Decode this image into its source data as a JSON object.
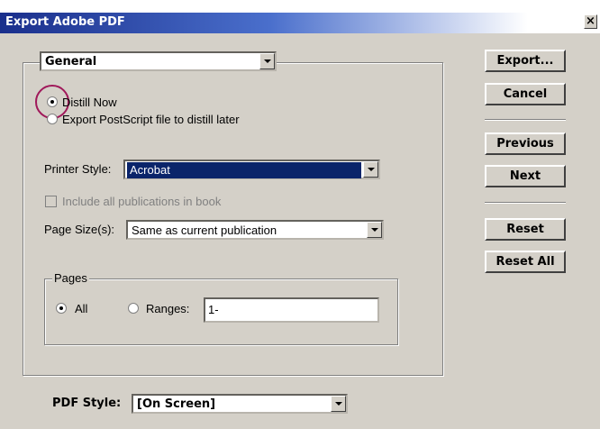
{
  "window": {
    "title": "Export Adobe PDF",
    "close_glyph": "×"
  },
  "category_select": {
    "value": "General"
  },
  "distill": {
    "now_label": "Distill Now",
    "later_label": "Export PostScript file to distill later",
    "selected": "now"
  },
  "printer_style": {
    "label": "Printer Style:",
    "value": "Acrobat"
  },
  "include_all": {
    "label": "Include all publications in book"
  },
  "page_size": {
    "label": "Page Size(s):",
    "value": "Same as current publication"
  },
  "pages": {
    "group_label": "Pages",
    "all_label": "All",
    "ranges_label": "Ranges:",
    "ranges_value": "1-"
  },
  "pdf_style": {
    "label": "PDF Style:",
    "value": "[On Screen]"
  },
  "buttons": {
    "export": "Export...",
    "cancel": "Cancel",
    "previous": "Previous",
    "next": "Next",
    "reset": "Reset",
    "reset_all": "Reset All"
  },
  "colors": {
    "highlight_circle": "#a0185a",
    "selection_bg": "#0a246a"
  }
}
